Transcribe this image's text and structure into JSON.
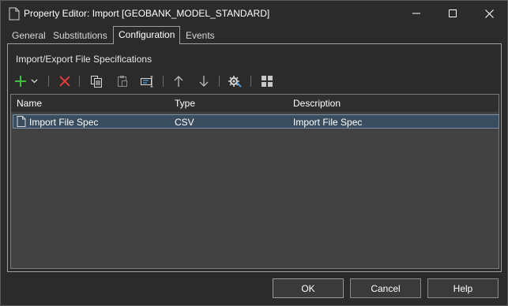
{
  "window": {
    "title": "Property Editor: Import [GEOBANK_MODEL_STANDARD]"
  },
  "tabs": [
    {
      "label": "General"
    },
    {
      "label": "Substitutions"
    },
    {
      "label": "Configuration",
      "active": true
    },
    {
      "label": "Events"
    }
  ],
  "section": {
    "title": "Import/Export File Specifications"
  },
  "toolbar": {
    "icons": [
      "add-icon",
      "dropdown-arrow-icon",
      "delete-icon",
      "copy-icon",
      "paste-icon",
      "rename-icon",
      "move-up-icon",
      "move-down-icon",
      "configure-icon",
      "grid-view-icon"
    ]
  },
  "list": {
    "columns": [
      "Name",
      "Type",
      "Description"
    ],
    "rows": [
      {
        "name": "Import File Spec",
        "type": "CSV",
        "description": "Import File Spec",
        "selected": true
      }
    ]
  },
  "buttons": {
    "ok": "OK",
    "cancel": "Cancel",
    "help": "Help"
  },
  "colors": {
    "background": "#2b2b2b",
    "list_background": "#424242",
    "selection": "#3a4d5f",
    "add_green": "#3fbf3f",
    "delete_red": "#e03a3a"
  }
}
